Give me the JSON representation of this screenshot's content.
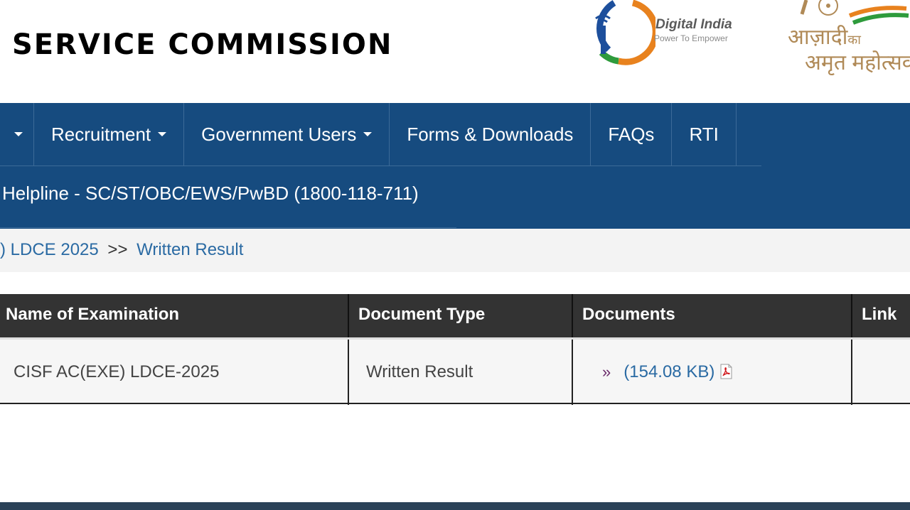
{
  "header": {
    "title": "SERVICE COMMISSION",
    "digital_india": {
      "name": "Digital India",
      "tagline": "Power To Empower"
    },
    "azadi": {
      "line1": "आज़ादी",
      "line1_small": "का",
      "line2": "अमृत महोत्सव"
    }
  },
  "nav": {
    "items": [
      {
        "label": "",
        "has_caret": true
      },
      {
        "label": "Recruitment",
        "has_caret": true
      },
      {
        "label": "Government Users",
        "has_caret": true
      },
      {
        "label": "Forms & Downloads",
        "has_caret": false
      },
      {
        "label": "FAQs",
        "has_caret": false
      },
      {
        "label": "RTI",
        "has_caret": false
      }
    ],
    "helpline": "Helpline - SC/ST/OBC/EWS/PwBD (1800-118-711)"
  },
  "breadcrumb": {
    "parent": ") LDCE 2025",
    "separator": ">>",
    "current": "Written Result"
  },
  "table": {
    "columns": [
      "Name of Examination",
      "Document Type",
      "Documents",
      "Link"
    ],
    "rows": [
      {
        "exam": "CISF AC(EXE) LDCE-2025",
        "doc_type": "Written Result",
        "doc_arrow": "»",
        "doc_size": "(154.08 KB)",
        "doc_icon": "pdf-icon",
        "link": ""
      }
    ]
  },
  "colors": {
    "nav_bg": "#164b7f",
    "table_header_bg": "#333333",
    "link": "#2a6aa3",
    "breadcrumb_bg": "#f3f3f3"
  }
}
